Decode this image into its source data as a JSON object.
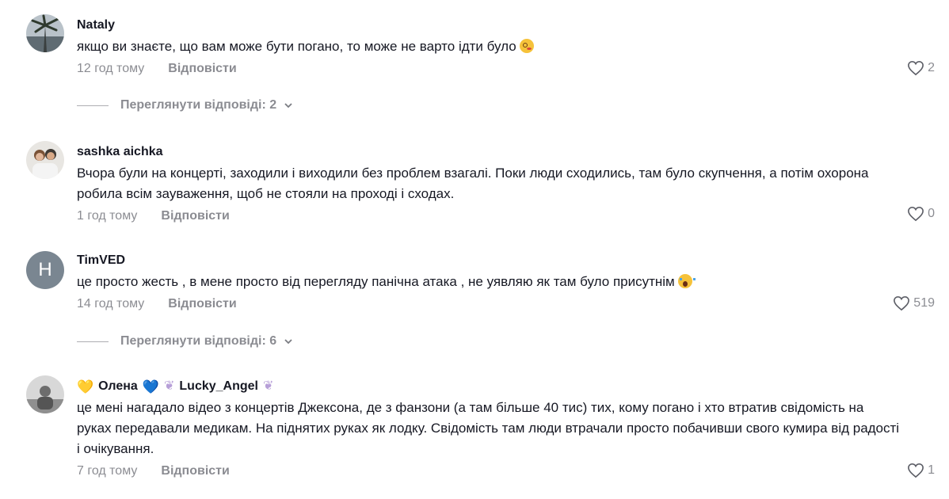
{
  "like_icon": "heart-outline-icon",
  "reply_chevron_icon": "chevron-down-icon",
  "comments": [
    {
      "username": "Nataly",
      "text": "якщо ви знаєте, що вам може бути погано, то може не варто ідти було",
      "emoji": "dizzy-face-emoji",
      "time": "12 год тому",
      "reply_label": "Відповісти",
      "likes": "2",
      "view_replies": "Переглянути відповіді: 2"
    },
    {
      "username": "sashka aichka",
      "text": "Вчора були на концерті, заходили і виходили без проблем взагалі. Поки люди сходились, там було скупчення, а потім охорона робила всім зауваження, щоб не стояли на проході і сходах.",
      "time": "1 год тому",
      "reply_label": "Відповісти",
      "likes": "0"
    },
    {
      "username": "TimVED",
      "avatar_letter": "H",
      "text": "це просто жесть , в мене просто від перегляду панічна атака , не уявляю як там було присутнім",
      "emoji": "screaming-face-emoji",
      "time": "14 год тому",
      "reply_label": "Відповісти",
      "likes": "519",
      "view_replies": "Переглянути відповіді: 6"
    },
    {
      "username_part1": "Олена",
      "username_part2": "Lucky_Angel",
      "username_emojis": [
        "💛",
        "💙",
        "wing-emoji",
        "wing-emoji"
      ],
      "text": "це мені нагадало відео з концертів Джексона, де з фанзони (а там більше 40 тис) тих, кому погано і хто втратив свідомість на руках передавали медикам. На піднятих руках як лодку. Свідомість там люди втрачали просто побачивши свого кумира від радості і очікування.",
      "time": "7 год тому",
      "reply_label": "Відповісти",
      "likes": "1"
    }
  ],
  "colors": {
    "primary_text": "#161823",
    "secondary_text": "rgba(22,24,35,0.5)",
    "avatar_letter_bg": "#7a8691"
  }
}
